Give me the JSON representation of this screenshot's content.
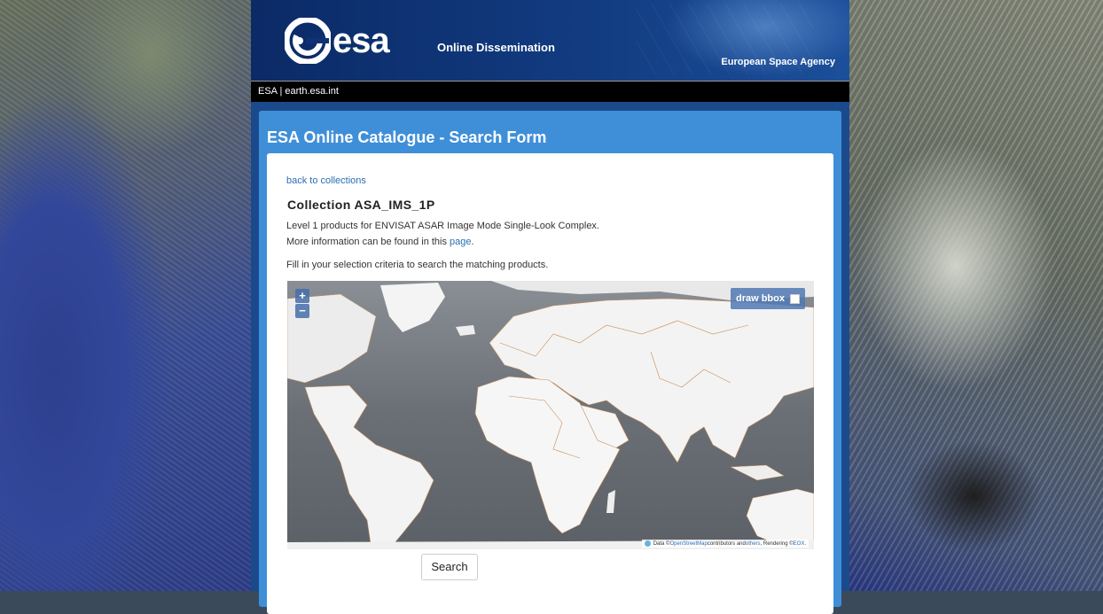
{
  "header": {
    "logo_text": "esa",
    "tagline": "Online Dissemination",
    "agency": "European Space Agency"
  },
  "topbar": {
    "breadcrumb": "ESA | earth.esa.int"
  },
  "panel": {
    "title": "ESA Online Catalogue - Search Form"
  },
  "content": {
    "back_link": "back to collections",
    "collection_title": "Collection ASA_IMS_1P",
    "description_line1": "Level 1 products for ENVISAT ASAR Image Mode Single-Look Complex.",
    "description_line2_prefix": "More information can be found in this ",
    "description_line2_link": "page",
    "description_line2_suffix": ".",
    "instruction": "Fill in your selection criteria to search the matching products."
  },
  "map": {
    "zoom_in": "+",
    "zoom_out": "−",
    "bbox_label": "draw bbox",
    "bbox_checked": false,
    "attribution_prefix": "Data © ",
    "attribution_osm": "OpenStreetMap",
    "attribution_mid": " contributors and ",
    "attribution_others": "others",
    "attribution_rendering": ", Rendering © ",
    "attribution_eox": "EOX",
    "attribution_end": "."
  },
  "form": {
    "search_label": "Search"
  },
  "colors": {
    "panel_blue": "#3f8fd8",
    "link_blue": "#2a6fb5",
    "header_navy": "#0b2a66"
  }
}
